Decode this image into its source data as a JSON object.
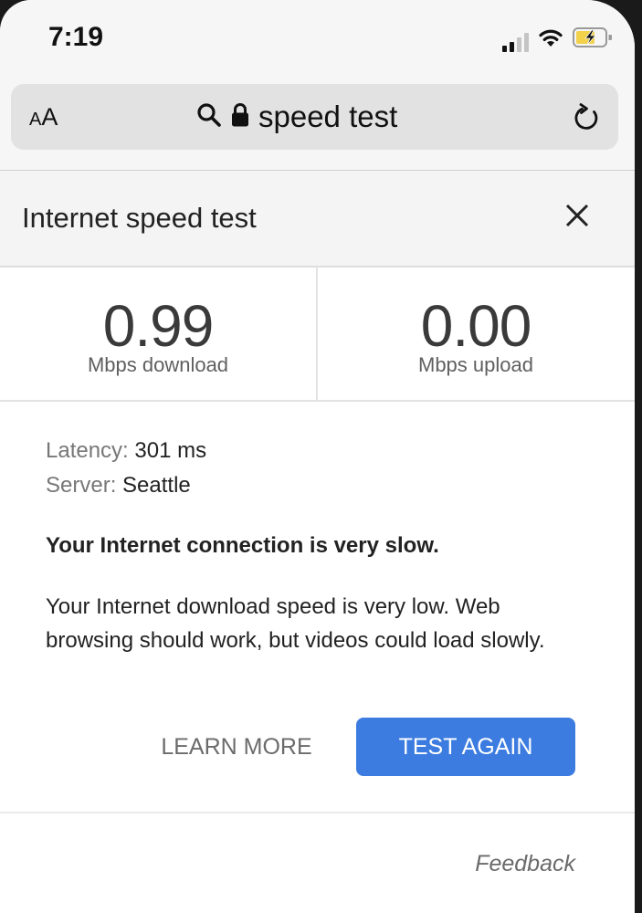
{
  "status_bar": {
    "time": "7:19"
  },
  "browser": {
    "text_size_button": "AA",
    "url": "speed test"
  },
  "widget": {
    "title": "Internet speed test",
    "download": {
      "value": "0.99",
      "unit": "Mbps download"
    },
    "upload": {
      "value": "0.00",
      "unit": "Mbps upload"
    },
    "latency": {
      "label": "Latency:",
      "value": "301 ms"
    },
    "server": {
      "label": "Server:",
      "value": "Seattle"
    },
    "headline": "Your Internet connection is very slow.",
    "description": "Your Internet download speed is very low. Web browsing should work, but videos could load slowly.",
    "learn_more_label": "LEARN MORE",
    "test_again_label": "TEST AGAIN",
    "feedback_label": "Feedback"
  },
  "colors": {
    "accent_button": "#3c7ce0",
    "battery_charging": "#f2d14b"
  }
}
